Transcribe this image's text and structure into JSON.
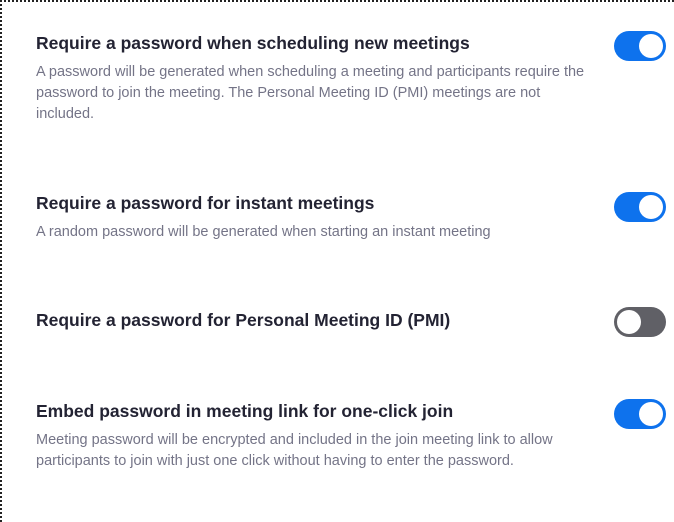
{
  "settings": [
    {
      "title": "Require a password when scheduling new meetings",
      "description": "A password will be generated when scheduling a meeting and participants require the password to join the meeting. The Personal Meeting ID (PMI) meetings are not included.",
      "enabled": true
    },
    {
      "title": "Require a password for instant meetings",
      "description": "A random password will be generated when starting an instant meeting",
      "enabled": true
    },
    {
      "title": "Require a password for Personal Meeting ID (PMI)",
      "description": "",
      "enabled": false
    },
    {
      "title": "Embed password in meeting link for one-click join",
      "description": "Meeting password will be encrypted and included in the join meeting link to allow participants to join with just one click without having to enter the password.",
      "enabled": true
    }
  ],
  "colors": {
    "toggle_on": "#0e72ed",
    "toggle_off": "#606066",
    "title_text": "#232333",
    "description_text": "#747487"
  }
}
